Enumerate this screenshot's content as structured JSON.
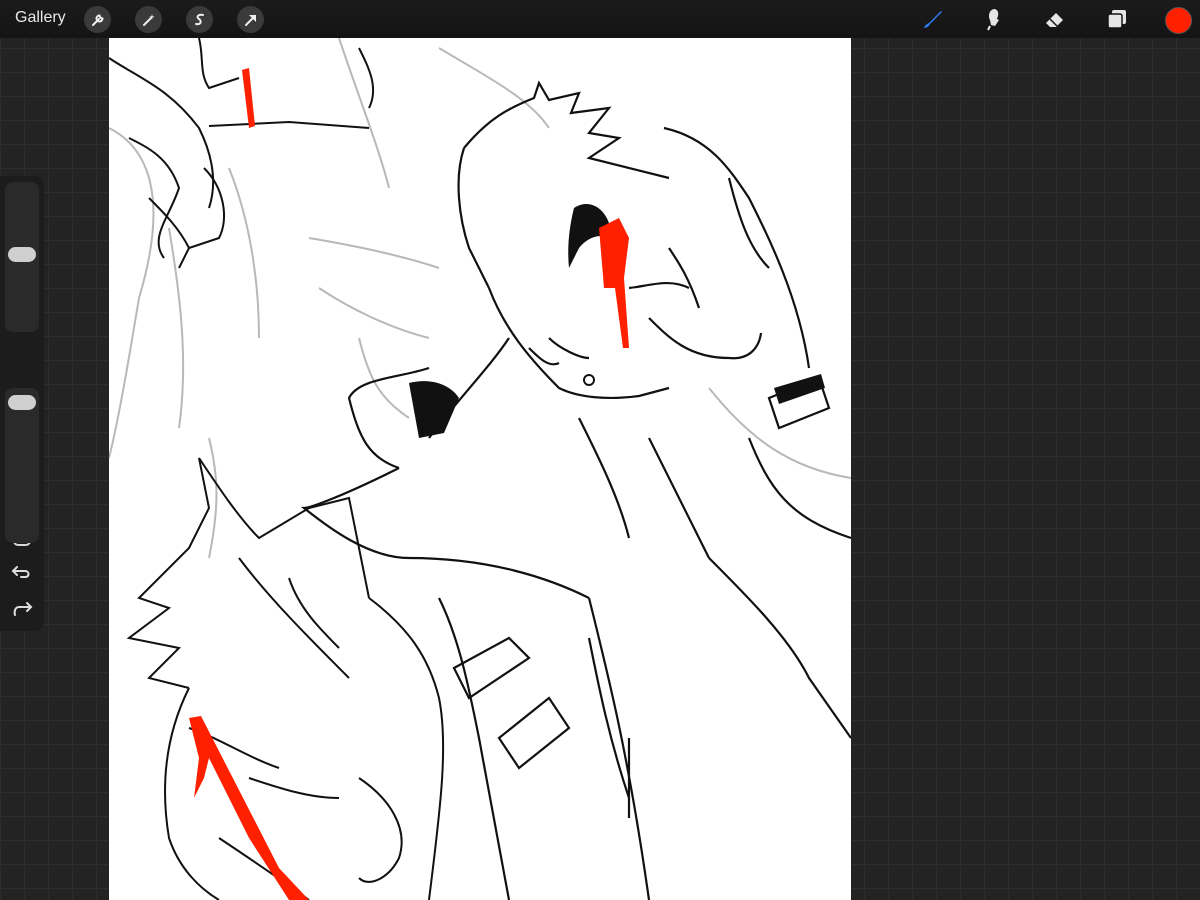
{
  "app": {
    "gallery_label": "Gallery"
  },
  "toolbar": {
    "left_icons": [
      "wrench-icon",
      "magic-wand-icon",
      "selection-icon",
      "transform-arrow-icon"
    ],
    "right_icons": [
      "brush-icon",
      "smudge-icon",
      "eraser-icon",
      "layers-icon"
    ],
    "active_tool": "brush",
    "accent_color": "#2f7bf5",
    "current_color": "#ff2000"
  },
  "sidebar": {
    "brush_size_level": 0.2,
    "opacity_level": 0.05,
    "icons": [
      "modify-square-icon",
      "undo-icon",
      "redo-icon"
    ]
  },
  "canvas": {
    "background": "#ffffff",
    "line_color": "#000000",
    "sketch_color": "#b8b8b8",
    "blood_color": "#ff2000"
  }
}
